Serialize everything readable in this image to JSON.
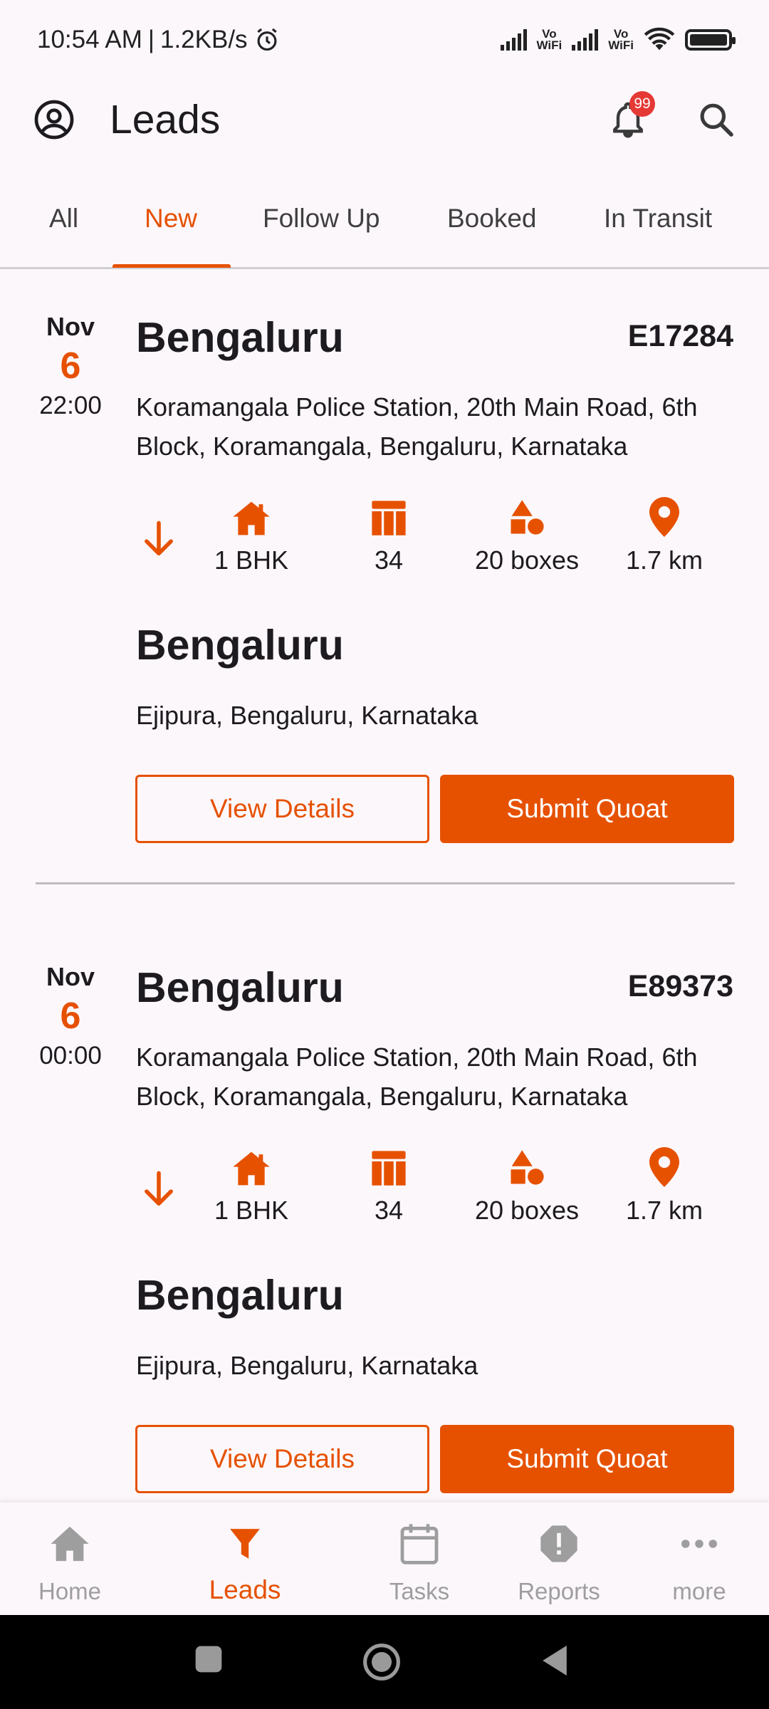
{
  "status_bar": {
    "time": "10:54 AM",
    "separator": "|",
    "speed": "1.2KB/s",
    "vo_label_1": "Vo",
    "wifi_label_1": "WiFi",
    "vo_label_2": "Vo",
    "wifi_label_2": "WiFi"
  },
  "app_bar": {
    "title": "Leads",
    "notification_count": "99"
  },
  "tabs": [
    {
      "label": "All",
      "active": false
    },
    {
      "label": "New",
      "active": true
    },
    {
      "label": "Follow Up",
      "active": false
    },
    {
      "label": "Booked",
      "active": false
    },
    {
      "label": "In Transit",
      "active": false
    }
  ],
  "leads": [
    {
      "month": "Nov",
      "day": "6",
      "time": "22:00",
      "origin_city": "Bengaluru",
      "lead_id": "E17284",
      "origin_address": "Koramangala Police Station, 20th Main Road, 6th Block, Koramangala, Bengaluru, Karnataka",
      "house_type": "1 BHK",
      "items_count": "34",
      "boxes": "20 boxes",
      "distance": "1.7 km",
      "destination_city": "Bengaluru",
      "destination_address": "Ejipura, Bengaluru, Karnataka",
      "view_label": "View Details",
      "submit_label": "Submit Quoat"
    },
    {
      "month": "Nov",
      "day": "6",
      "time": "00:00",
      "origin_city": "Bengaluru",
      "lead_id": "E89373",
      "origin_address": "Koramangala Police Station, 20th Main Road, 6th Block, Koramangala, Bengaluru, Karnataka",
      "house_type": "1 BHK",
      "items_count": "34",
      "boxes": "20 boxes",
      "distance": "1.7 km",
      "destination_city": "Bengaluru",
      "destination_address": "Ejipura, Bengaluru, Karnataka",
      "view_label": "View Details",
      "submit_label": "Submit Quoat"
    }
  ],
  "bottom_nav": [
    {
      "label": "Home",
      "icon": "home-icon",
      "active": false
    },
    {
      "label": "Leads",
      "icon": "filter-icon",
      "active": true
    },
    {
      "label": "Tasks",
      "icon": "calendar-icon",
      "active": false
    },
    {
      "label": "Reports",
      "icon": "alert-icon",
      "active": false
    },
    {
      "label": "more",
      "icon": "more-icon",
      "active": false
    }
  ],
  "colors": {
    "accent": "#e65100",
    "background": "#fcf7fb",
    "inactive": "#9e9e9e",
    "badge": "#e53935"
  }
}
